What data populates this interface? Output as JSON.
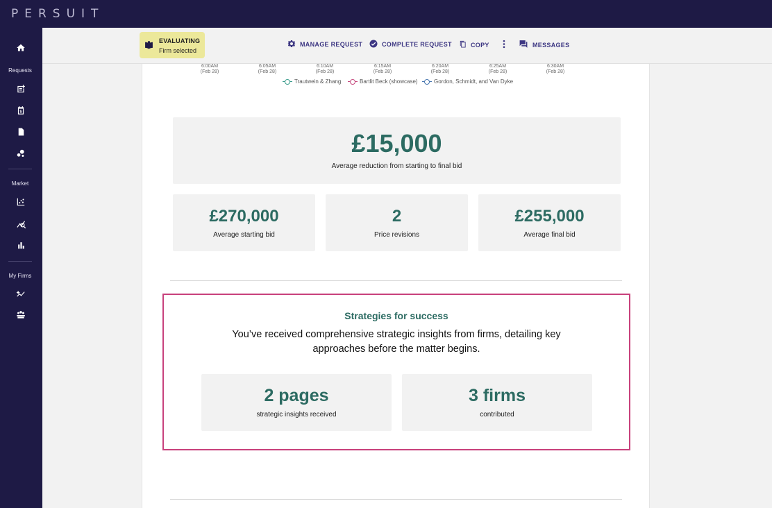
{
  "brand": {
    "logo": "PERSUIT"
  },
  "sidebar": {
    "sections": {
      "requests": "Requests",
      "market": "Market",
      "my_firms": "My Firms"
    }
  },
  "actionbar": {
    "status": {
      "state": "EVALUATING",
      "detail": "Firm selected"
    },
    "manage": "MANAGE REQUEST",
    "complete": "COMPLETE REQUEST",
    "copy": "COPY",
    "messages": "MESSAGES"
  },
  "chart": {
    "time_labels": [
      {
        "time": "6:00AM",
        "date": "(Feb 28)"
      },
      {
        "time": "6:05AM",
        "date": "(Feb 28)"
      },
      {
        "time": "6:10AM",
        "date": "(Feb 28)"
      },
      {
        "time": "6:15AM",
        "date": "(Feb 28)"
      },
      {
        "time": "6:20AM",
        "date": "(Feb 28)"
      },
      {
        "time": "6:25AM",
        "date": "(Feb 28)"
      },
      {
        "time": "6:30AM",
        "date": "(Feb 28)"
      }
    ],
    "legend": [
      "Trautwein & Zhang",
      "Bartlit Beck (showcase)",
      "Gordon, Schmidt, and Van Dyke"
    ]
  },
  "summary": {
    "main": {
      "value": "£15,000",
      "label": "Average reduction from starting to final bid"
    },
    "starting": {
      "value": "£270,000",
      "label": "Average starting bid"
    },
    "revisions": {
      "value": "2",
      "label": "Price revisions"
    },
    "final": {
      "value": "£255,000",
      "label": "Average final bid"
    }
  },
  "strategies": {
    "title": "Strategies for success",
    "description": "You’ve received comprehensive strategic insights from firms, detailing key approaches before the matter begins.",
    "pages": {
      "value": "2 pages",
      "label": "strategic insights received"
    },
    "firms": {
      "value": "3 firms",
      "label": "contributed"
    }
  },
  "colors": {
    "accent": "#2c6b62",
    "nav": "#1e1a45",
    "highlight": "#c8417c",
    "chip": "#ece89a",
    "action": "#3c3682"
  }
}
